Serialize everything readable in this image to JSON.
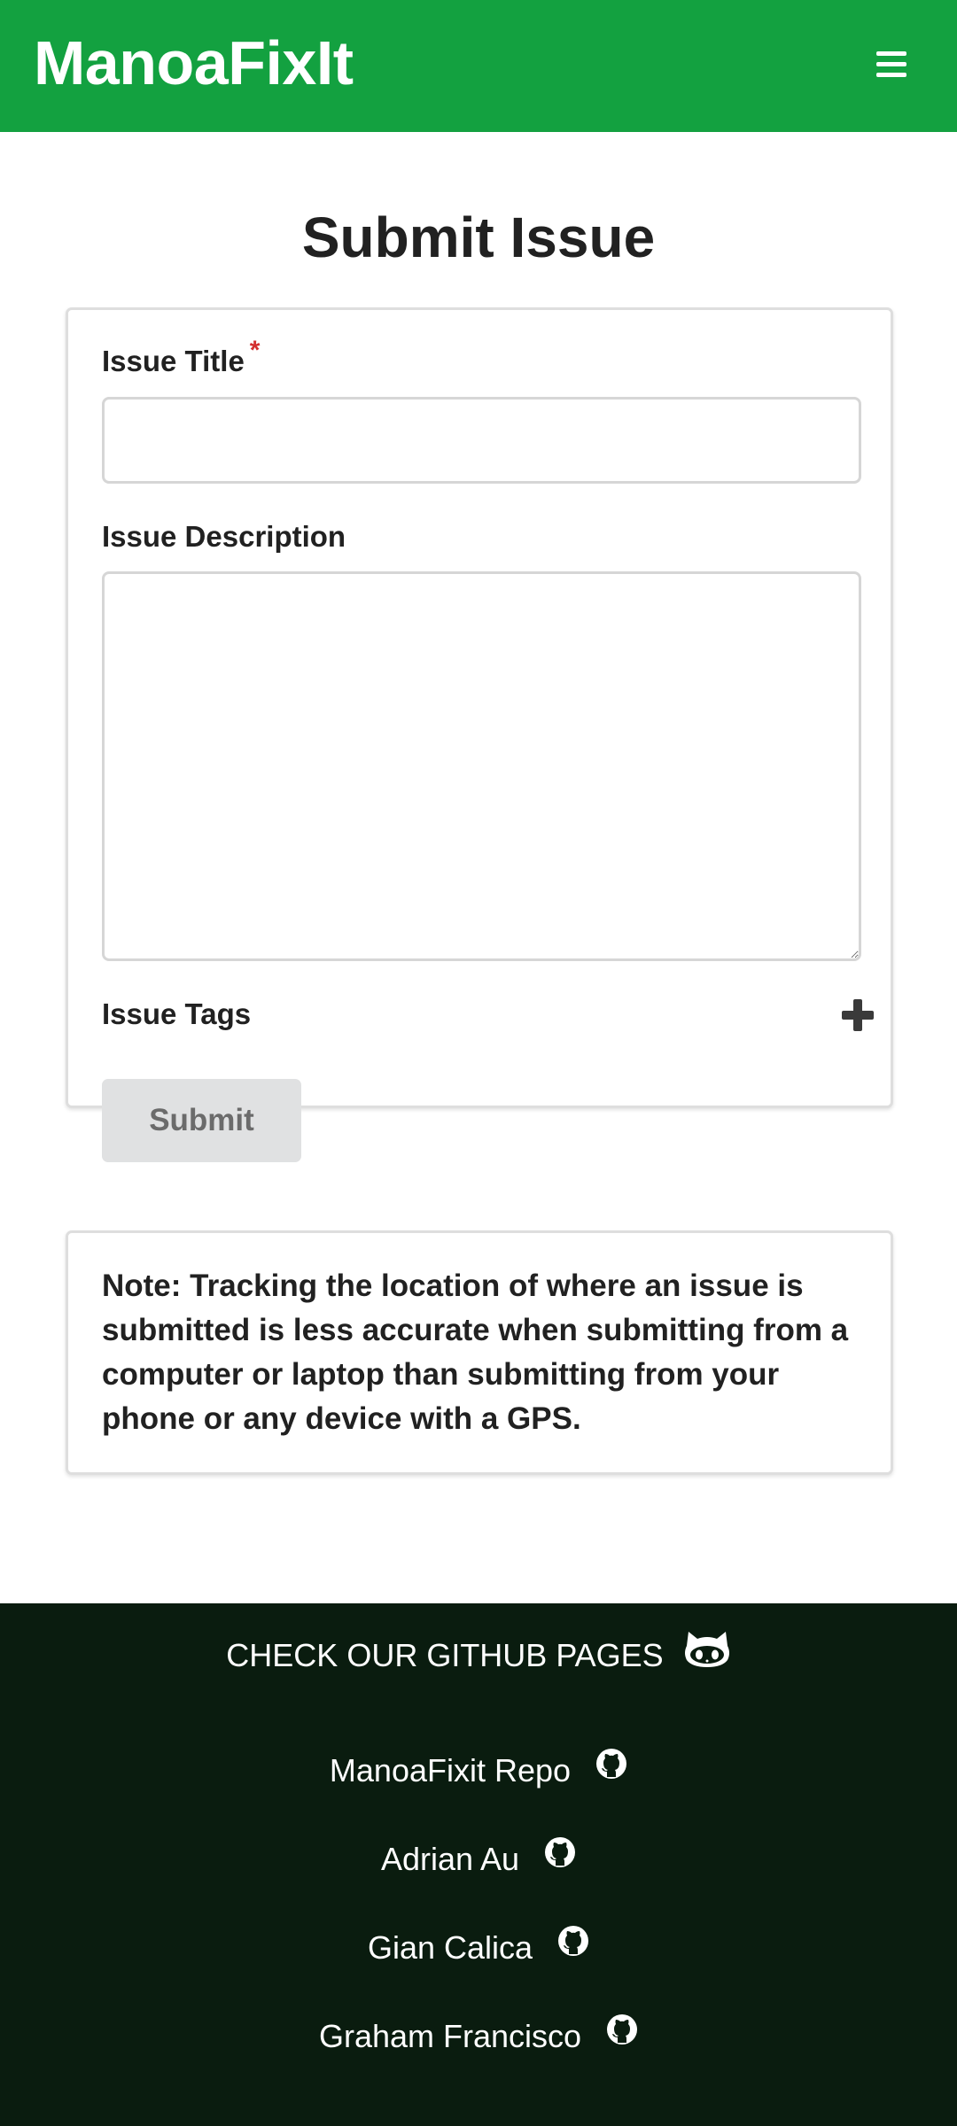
{
  "navbar": {
    "brand": "ManoaFixIt",
    "menu_icon": "hamburger-menu-icon"
  },
  "page": {
    "title": "Submit Issue"
  },
  "form": {
    "title_label": "Issue Title",
    "required_marker": "*",
    "title_value": "",
    "description_label": "Issue Description",
    "description_value": "",
    "tags_label": "Issue Tags",
    "add_tag_icon": "plus-icon",
    "submit_label": "Submit"
  },
  "note": {
    "text": "Note: Tracking the location of where an issue is submitted is less accurate when submitting from a computer or laptop than submitting from your phone or any device with a GPS."
  },
  "footer": {
    "heading": "CHECK OUR GITHUB PAGES",
    "heading_icon": "github-octocat-icon",
    "links": [
      {
        "label": "ManoaFixit Repo",
        "icon": "github-icon"
      },
      {
        "label": "Adrian Au",
        "icon": "github-icon"
      },
      {
        "label": "Gian Calica",
        "icon": "github-icon"
      },
      {
        "label": "Graham Francisco",
        "icon": "github-icon"
      }
    ]
  },
  "colors": {
    "navbar": "#13a140",
    "footer": "#0a1c0f",
    "required": "#d32f2f",
    "submit_button": "#e0e1e2"
  }
}
